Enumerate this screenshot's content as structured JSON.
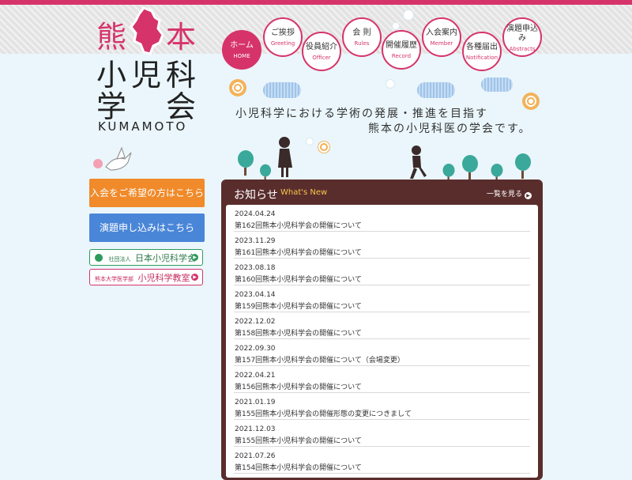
{
  "logo": {
    "kuma": "熊",
    "moto": "本",
    "line1": "小児科",
    "line2": "学　会",
    "en": "KUMAMOTO"
  },
  "nav": [
    {
      "jp": "ホーム",
      "en": "HOME"
    },
    {
      "jp": "ご挨拶",
      "en": "Greeting"
    },
    {
      "jp": "役員紹介",
      "en": "Officer"
    },
    {
      "jp": "会 則",
      "en": "Rules"
    },
    {
      "jp": "開催履歴",
      "en": "Record"
    },
    {
      "jp": "入会案内",
      "en": "Member"
    },
    {
      "jp": "各種届出",
      "en": "Notification"
    },
    {
      "jp": "演題申込み",
      "en": "Abstracts"
    }
  ],
  "tagline": {
    "line1": "小児科学における学術の発展・推進を目指す",
    "line2": "熊本の小児科医の学会です。"
  },
  "sidebar": {
    "join_button": "入会をご希望の方はこちら",
    "abstract_button": "演題申し込みはこちら",
    "jps_small": "社団法人",
    "jps": "日本小児科学会",
    "kuma_small": "熊本大学医学部",
    "kuma": "小児科学教室"
  },
  "news": {
    "title": "お知らせ",
    "title_en": "What's New",
    "more": "一覧を見る",
    "items": [
      {
        "date": "2024.04.24",
        "title": "第162回熊本小児科学会の開催について"
      },
      {
        "date": "2023.11.29",
        "title": "第161回熊本小児科学会の開催について"
      },
      {
        "date": "2023.08.18",
        "title": "第160回熊本小児科学会の開催について"
      },
      {
        "date": "2023.04.14",
        "title": "第159回熊本小児科学会の開催について"
      },
      {
        "date": "2022.12.02",
        "title": "第158回熊本小児科学会の開催について"
      },
      {
        "date": "2022.09.30",
        "title": "第157回熊本小児科学会の開催について（会場変更）"
      },
      {
        "date": "2022.04.21",
        "title": "第156回熊本小児科学会の開催について"
      },
      {
        "date": "2021.01.19",
        "title": "第155回熊本小児科学会の開催形態の変更につきまして"
      },
      {
        "date": "2021.12.03",
        "title": "第155回熊本小児科学会の開催について"
      },
      {
        "date": "2021.07.26",
        "title": "第154回熊本小児科学会の開催について"
      }
    ]
  },
  "colors": {
    "accent": "#d6336a",
    "join": "#f08a2a",
    "abstract": "#4a86d8",
    "news_bg": "#5a2d2d"
  }
}
